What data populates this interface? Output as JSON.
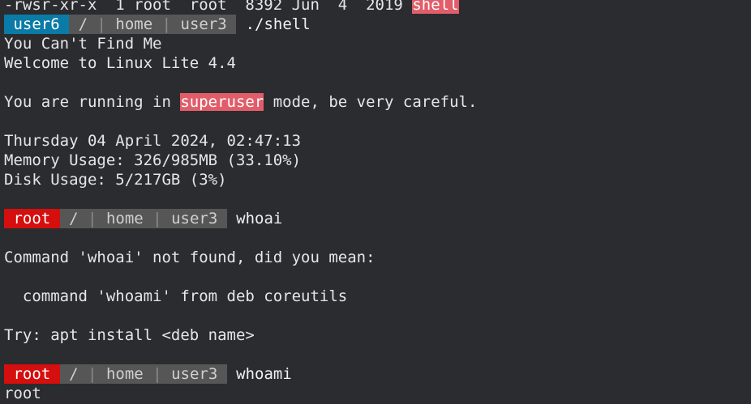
{
  "terminal": {
    "ls_line": {
      "text": "-rwsr-xr-x  1 root  root  8392 Jun  4  2019 ",
      "filename": "shell"
    },
    "prompt1": {
      "user": "user6",
      "path": [
        "/",
        "home",
        "user3"
      ],
      "command": "./shell"
    },
    "banner_line1": "You Can't Find Me",
    "banner_line2": "Welcome to Linux Lite 4.4",
    "superuser_line": {
      "before": "You are running in ",
      "highlight": "superuser",
      "after": " mode, be very careful."
    },
    "datetime": "Thursday 04 April 2024, 02:47:13",
    "memory": "Memory Usage: 326/985MB (33.10%)",
    "disk": "Disk Usage: 5/217GB (3%)",
    "prompt2": {
      "user": "root",
      "path": [
        "/",
        "home",
        "user3"
      ],
      "command": "whoai"
    },
    "not_found": "Command 'whoai' not found, did you mean:",
    "suggestion": "  command 'whoami' from deb coreutils",
    "try_line": "Try: apt install <deb name>",
    "prompt3": {
      "user": "root",
      "path": [
        "/",
        "home",
        "user3"
      ],
      "command": "whoami"
    },
    "output": "root",
    "separator": "|"
  },
  "colors": {
    "background": "#2a2c30",
    "user_segment": "#0a7ba6",
    "root_segment": "#d50e0e",
    "path_segment": "#565656",
    "highlight": "#e25d6a"
  }
}
